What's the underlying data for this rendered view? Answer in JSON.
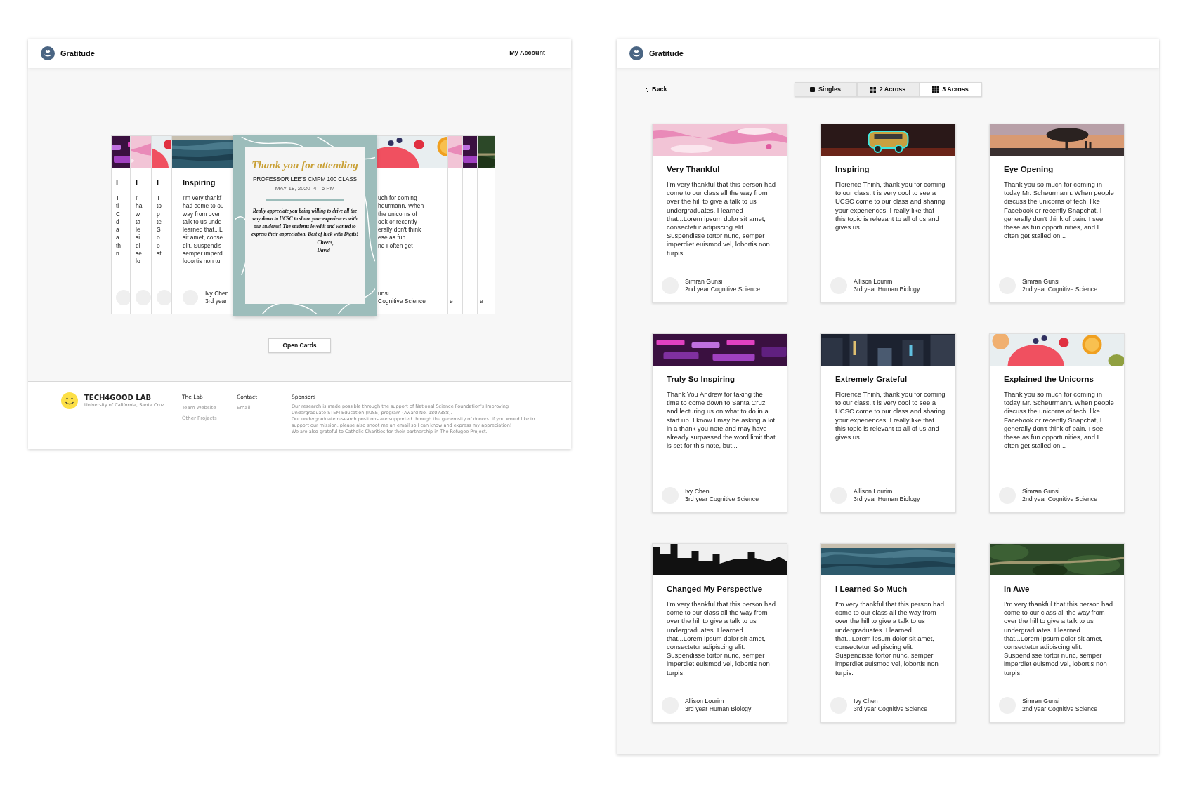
{
  "left_frame": {
    "header": {
      "app_name": "Gratitude",
      "account_link": "My Account"
    },
    "card_stack": {
      "left_cards": [
        {
          "title": "I",
          "lines": [
            "T",
            "ti",
            "C",
            "d",
            "a",
            "a",
            "th",
            "n"
          ]
        },
        {
          "title": "I",
          "lines": [
            "I'",
            "ha",
            "w",
            "ta",
            "le",
            "si",
            "el",
            "se",
            "lo"
          ]
        },
        {
          "title": "I",
          "lines": [
            "T",
            "to",
            "p",
            "te",
            "S",
            "o",
            "o",
            "st"
          ]
        },
        {
          "title": "Inspiring",
          "lines": [
            "I'm very thankf",
            "had come to ou",
            "way from over",
            "talk to us unde",
            "learned that...L",
            "sit amet, conse",
            "elit. Suspendis",
            "semper imperd",
            "lobortis non tu"
          ],
          "author": "Ivy Chen",
          "detail": "3rd year"
        }
      ],
      "invitation": {
        "heading": "Thank you for attending",
        "class_name": "PROFESSOR LEE'S CMPM 100 CLASS",
        "date": "MAY 18, 2020  4 - 6 PM",
        "message": "Really appreciate you being willing to drive all the way down to UCSC to share your experiences with our students! The students loved it and wanted to express their appreciation. Best of luck with Digits!",
        "closing": "Cheers,",
        "signature": "David"
      },
      "right_cards": [
        {
          "kind": "wide",
          "lines": [
            "uch for coming",
            "heurmann. When",
            "the unicorns of",
            "ook or recently",
            "erally don't think",
            "ese as fun",
            "nd I often get"
          ],
          "author": "unsi",
          "detail": "Cognitive Science"
        },
        {
          "kind": "narrow",
          "detail": "e"
        },
        {
          "kind": "narrow"
        },
        {
          "kind": "narrow",
          "detail": "e"
        }
      ]
    },
    "open_button": "Open Cards",
    "footer": {
      "lab_name": "TECH4GOOD LAB",
      "university": "University of California, Santa Cruz",
      "columns": [
        {
          "heading": "The Lab",
          "links": [
            "Team Website",
            "Other Projects"
          ]
        },
        {
          "heading": "Contact",
          "links": [
            "Email"
          ]
        }
      ],
      "sponsors": {
        "heading": "Sponsors",
        "paragraphs": [
          "Our research is made possible through the support of National Science Foundation's Improving Undergraduate STEM Education (IUSE) program (Award No. 1807388).",
          "Our undergraduate research positions are supported through the generosity of donors. If you would like to support our mission, please also shoot me an email so I can know and express my appreciation!",
          "We are also grateful to Catholic Charities for their partnership in The Refugee Project."
        ]
      }
    }
  },
  "right_frame": {
    "header": {
      "app_name": "Gratitude"
    },
    "back": "Back",
    "view_tabs": [
      {
        "label": "Singles",
        "kind": "single",
        "selected": false
      },
      {
        "label": "2 Across",
        "kind": "grid2",
        "selected": false
      },
      {
        "label": "3 Across",
        "kind": "grid3",
        "selected": true
      }
    ],
    "cards": [
      {
        "title": "Very Thankful",
        "body": "I'm very thankful that this person had come to our class all the way from over the hill to give a talk to us undergraduates. I learned that...Lorem ipsum dolor sit amet, consectetur adipiscing elit. Suspendisse tortor nunc, semper imperdiet euismod vel, lobortis non turpis.",
        "author": "Simran Gunsi",
        "detail": "2nd year Cognitive Science"
      },
      {
        "title": "Inspiring",
        "body": "Florence Thinh, thank you for coming to our class.It is very cool to see a UCSC come to our class and sharing your experiences. I really like that this topic is relevant to all of us and gives us...",
        "author": "Allison Lourim",
        "detail": "3rd year Human Biology"
      },
      {
        "title": "Eye Opening",
        "body": "Thank you so much for coming in today Mr. Scheurmann. When people discuss the unicorns of tech, like Facebook or recently Snapchat, I generally don't think of pain. I see these as fun opportunities, and I often get stalled on...",
        "author": "Simran Gunsi",
        "detail": "2nd year Cognitive Science"
      },
      {
        "title": "Truly So Inspiring",
        "body": "Thank You Andrew for taking the time to come down to Santa Cruz and lecturing us on what to do in a start up. I know I may be asking a lot in a thank you note and may have already surpassed the word limit that is set for this note, but...",
        "author": "Ivy Chen",
        "detail": "3rd year Cognitive Science"
      },
      {
        "title": "Extremely Grateful",
        "body": "Florence Thinh, thank you for coming to our class.It is very cool to see a UCSC come to our class and sharing your experiences. I really like that this topic is relevant to all of us and gives us...",
        "author": "Allison Lourim",
        "detail": "3rd year Human Biology"
      },
      {
        "title": "Explained the Unicorns",
        "body": "Thank you so much for coming in today Mr. Scheurmann. When people discuss the unicorns of tech, like Facebook or recently Snapchat, I generally don't think of pain. I see these as fun opportunities, and I often get stalled on...",
        "author": "Simran Gunsi",
        "detail": "2nd year Cognitive Science"
      },
      {
        "title": "Changed My Perspective",
        "body": "I'm very thankful that this person had come to our class all the way from over the hill to give a talk to us undergraduates. I learned that...Lorem ipsum dolor sit amet, consectetur adipiscing elit. Suspendisse tortor nunc, semper imperdiet euismod vel, lobortis non turpis.",
        "author": "Allison Lourim",
        "detail": "3rd year Human Biology"
      },
      {
        "title": "I Learned So Much",
        "body": "I'm very thankful that this person had come to our class all the way from over the hill to give a talk to us undergraduates. I learned that...Lorem ipsum dolor sit amet, consectetur adipiscing elit. Suspendisse tortor nunc, semper imperdiet euismod vel, lobortis non turpis.",
        "author": "Ivy Chen",
        "detail": "3rd year Cognitive Science"
      },
      {
        "title": "In Awe",
        "body": "I'm very thankful that this person had come to our class all the way from over the hill to give a talk to us undergraduates. I learned that...Lorem ipsum dolor sit amet, consectetur adipiscing elit. Suspendisse tortor nunc, semper imperdiet euismod vel, lobortis non turpis.",
        "author": "Simran Gunsi",
        "detail": "2nd year Cognitive Science"
      }
    ]
  }
}
